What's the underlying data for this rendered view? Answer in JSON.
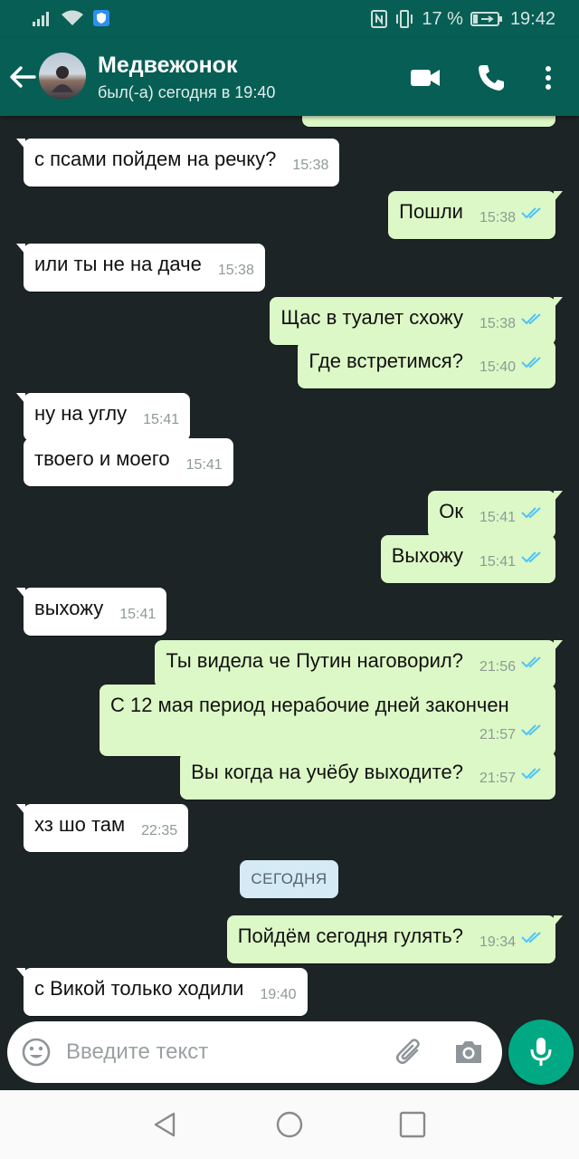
{
  "status_bar": {
    "battery_percent": "17 %",
    "time": "19:42"
  },
  "header": {
    "contact_name": "Медвежонок",
    "last_seen": "был(-а) сегодня в 19:40"
  },
  "messages": [
    {
      "direction": "in",
      "text": "с псами пойдем на речку?",
      "time": "15:38"
    },
    {
      "direction": "out",
      "text": "Пошли",
      "time": "15:38"
    },
    {
      "direction": "in",
      "text": "или ты не на даче",
      "time": "15:38"
    },
    {
      "direction": "out",
      "text": "Щас в туалет схожу",
      "time": "15:38"
    },
    {
      "direction": "out",
      "text": "Где встретимся?",
      "time": "15:40"
    },
    {
      "direction": "in",
      "text": "ну на углу",
      "time": "15:41"
    },
    {
      "direction": "in",
      "text": "твоего и моего",
      "time": "15:41"
    },
    {
      "direction": "out",
      "text": "Ок",
      "time": "15:41"
    },
    {
      "direction": "out",
      "text": "Выхожу",
      "time": "15:41"
    },
    {
      "direction": "in",
      "text": "выхожу",
      "time": "15:41"
    },
    {
      "direction": "out",
      "text": "Ты видела че Путин наговорил?",
      "time": "21:56"
    },
    {
      "direction": "out",
      "text": "С 12 мая период нерабочие дней закончен",
      "time": "21:57"
    },
    {
      "direction": "out",
      "text": "Вы когда на учёбу выходите?",
      "time": "21:57"
    },
    {
      "direction": "in",
      "text": "хз шо там",
      "time": "22:35"
    },
    {
      "direction": "out",
      "text": "Пойдём сегодня гулять?",
      "time": "19:34"
    },
    {
      "direction": "in",
      "text": "с Викой только ходили",
      "time": "19:40"
    }
  ],
  "date_separator": "СЕГОДНЯ",
  "composer": {
    "placeholder": "Введите текст"
  },
  "colors": {
    "header": "#075e54",
    "outgoing_bubble": "#dcf8c6",
    "incoming_bubble": "#ffffff",
    "read_ticks": "#4fc3f7",
    "mic_button": "#00a884"
  }
}
